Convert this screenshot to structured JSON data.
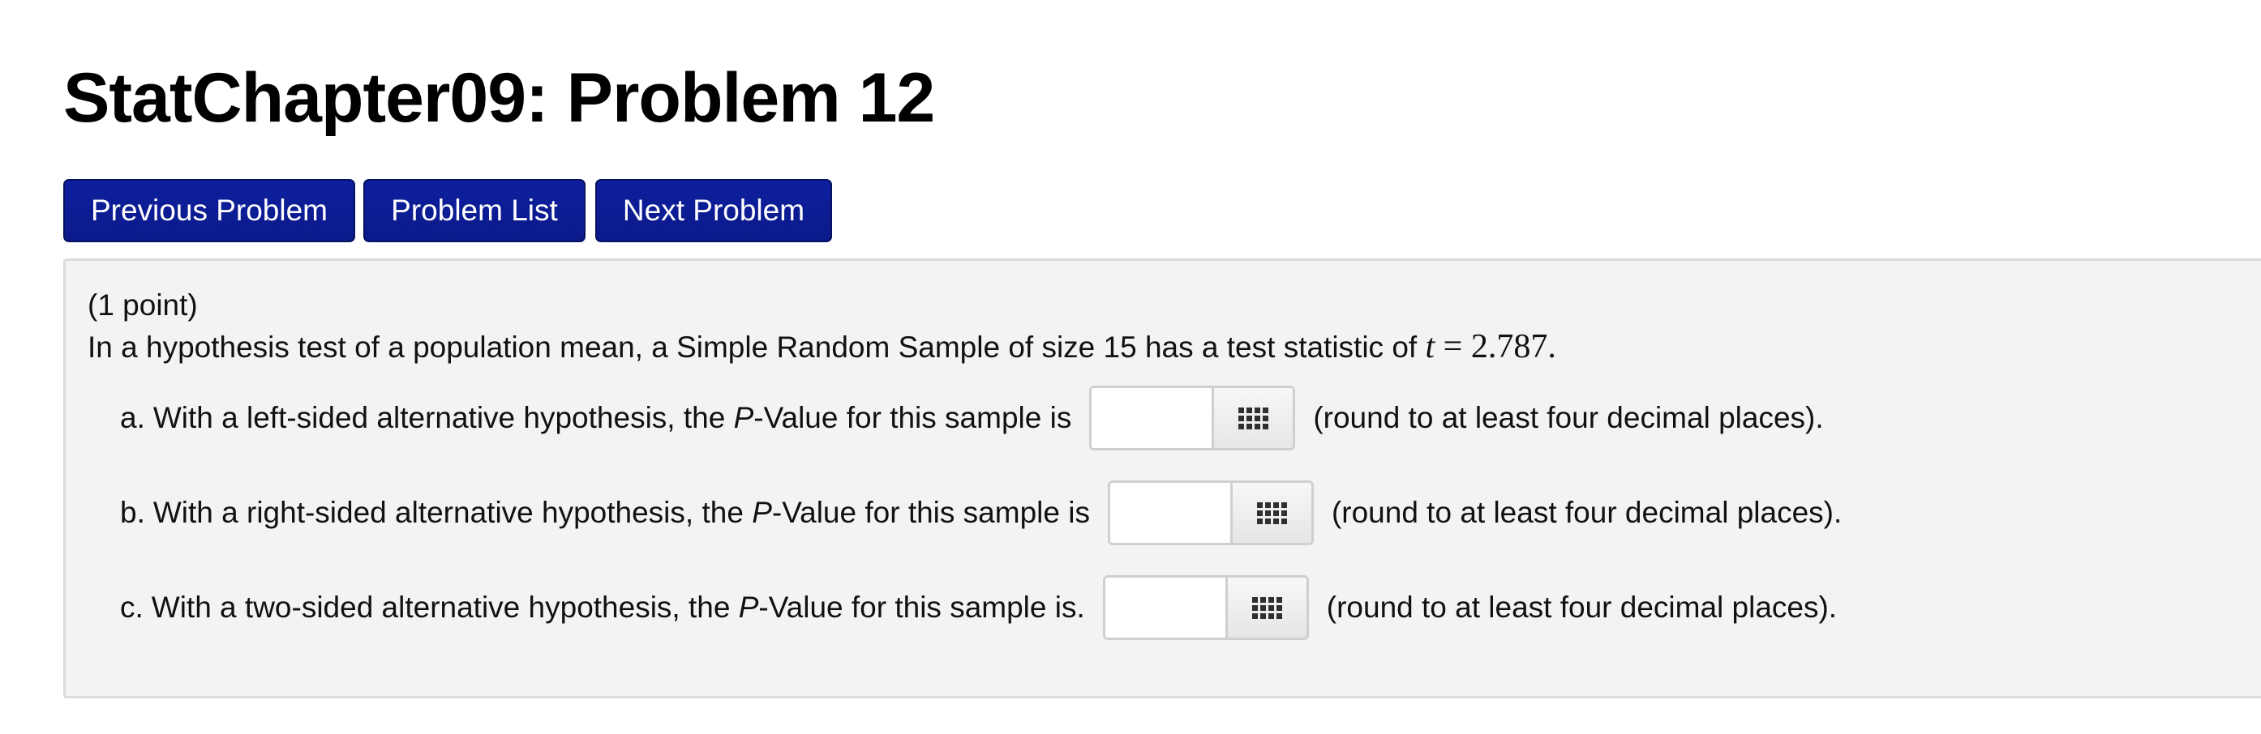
{
  "page_title": "StatChapter09: Problem 12",
  "nav": {
    "previous_label": "Previous Problem",
    "list_label": "Problem List",
    "next_label": "Next Problem"
  },
  "problem": {
    "points": "(1 point)",
    "statement_text": "In a hypothesis test of a population mean, a Simple Random Sample of size 15 has a test statistic of",
    "statistic_var": "t",
    "statistic_eq": " = 2.787.",
    "parts": [
      {
        "letter": "a.",
        "prefix": "With a left-sided alternative hypothesis, the",
        "p": "P",
        "suffix": "-Value for this sample is",
        "value": "",
        "hint": "(round to at least four decimal places)."
      },
      {
        "letter": "b.",
        "prefix": "With a right-sided alternative hypothesis, the",
        "p": "P",
        "suffix": "-Value for this sample is",
        "value": "",
        "hint": "(round to at least four decimal places)."
      },
      {
        "letter": "c.",
        "prefix": "With a two-sided alternative hypothesis, the",
        "p": "P",
        "suffix": "-Value for this sample is.",
        "value": "",
        "hint": "(round to at least four decimal places)."
      }
    ]
  },
  "icons": {
    "equation_palette": "grid-icon"
  }
}
